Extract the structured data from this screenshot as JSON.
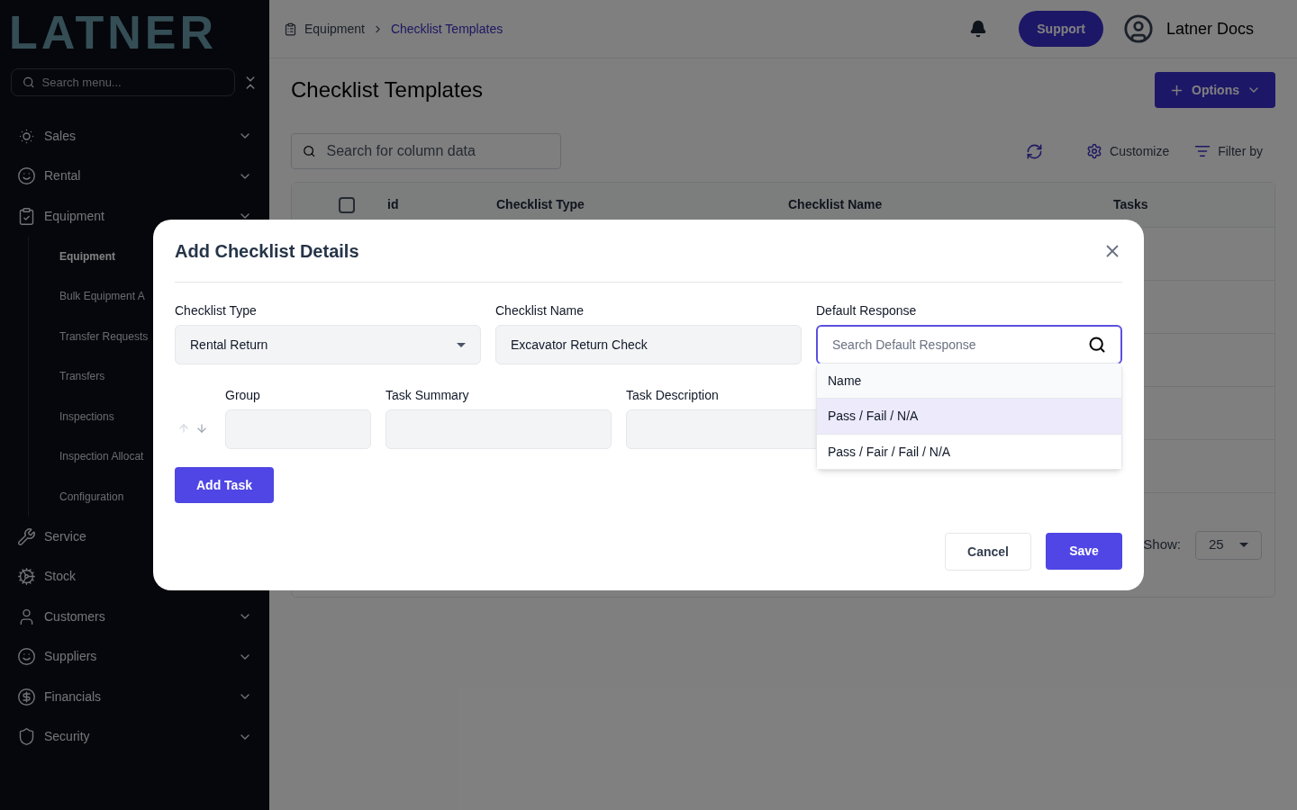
{
  "sidebar": {
    "logo": "LATNER",
    "search_placeholder": "Search menu...",
    "items": [
      {
        "label": "Sales",
        "chevron": true,
        "expanded": false
      },
      {
        "label": "Rental",
        "chevron": true,
        "expanded": false
      },
      {
        "label": "Equipment",
        "chevron": true,
        "expanded": true,
        "children": [
          {
            "label": "Equipment",
            "selected": true
          },
          {
            "label": "Bulk Equipment A",
            "selected": false
          },
          {
            "label": "Transfer Requests",
            "selected": false
          },
          {
            "label": "Transfers",
            "selected": false
          },
          {
            "label": "Inspections",
            "selected": false
          },
          {
            "label": "Inspection Allocat",
            "selected": false
          },
          {
            "label": "Configuration",
            "selected": false
          }
        ]
      },
      {
        "label": "Service",
        "chevron": false,
        "expanded": false
      },
      {
        "label": "Stock",
        "chevron": false,
        "expanded": false
      },
      {
        "label": "Customers",
        "chevron": true,
        "expanded": false
      },
      {
        "label": "Suppliers",
        "chevron": true,
        "expanded": false
      },
      {
        "label": "Financials",
        "chevron": true,
        "expanded": false
      },
      {
        "label": "Security",
        "chevron": true,
        "expanded": false
      }
    ]
  },
  "breadcrumb": [
    {
      "label": "Equipment",
      "current": false
    },
    {
      "label": "Checklist Templates",
      "current": true
    }
  ],
  "header": {
    "support": "Support",
    "user": "Latner Docs"
  },
  "page": {
    "title": "Checklist Templates",
    "options_button": "Options",
    "search_placeholder": "Search for column data",
    "toolbar": [
      "Customize",
      "Filter by"
    ],
    "table": {
      "select_all_checked": false,
      "columns": [
        "id",
        "Checklist Type",
        "Checklist Name",
        "Tasks"
      ]
    },
    "pagination": {
      "show_label": "Show:",
      "page_size": "25"
    }
  },
  "modal": {
    "title": "Add Checklist Details",
    "fields": [
      {
        "label": "Checklist Type",
        "kind": "select",
        "value": "Rental Return"
      },
      {
        "label": "Checklist Name",
        "kind": "text",
        "value": "Excavator Return Check"
      },
      {
        "label": "Default Response",
        "kind": "search",
        "placeholder": "Search Default Response",
        "focused": true
      }
    ],
    "task_columns": [
      "Group",
      "Task Summary",
      "Task Description"
    ],
    "dropdown": {
      "header": "Name",
      "options": [
        {
          "label": "Pass / Fail / N/A",
          "selected": true
        },
        {
          "label": "Pass / Fair / Fail / N/A",
          "selected": false
        }
      ]
    },
    "add_task": "Add Task",
    "cancel": "Cancel",
    "save": "Save"
  }
}
